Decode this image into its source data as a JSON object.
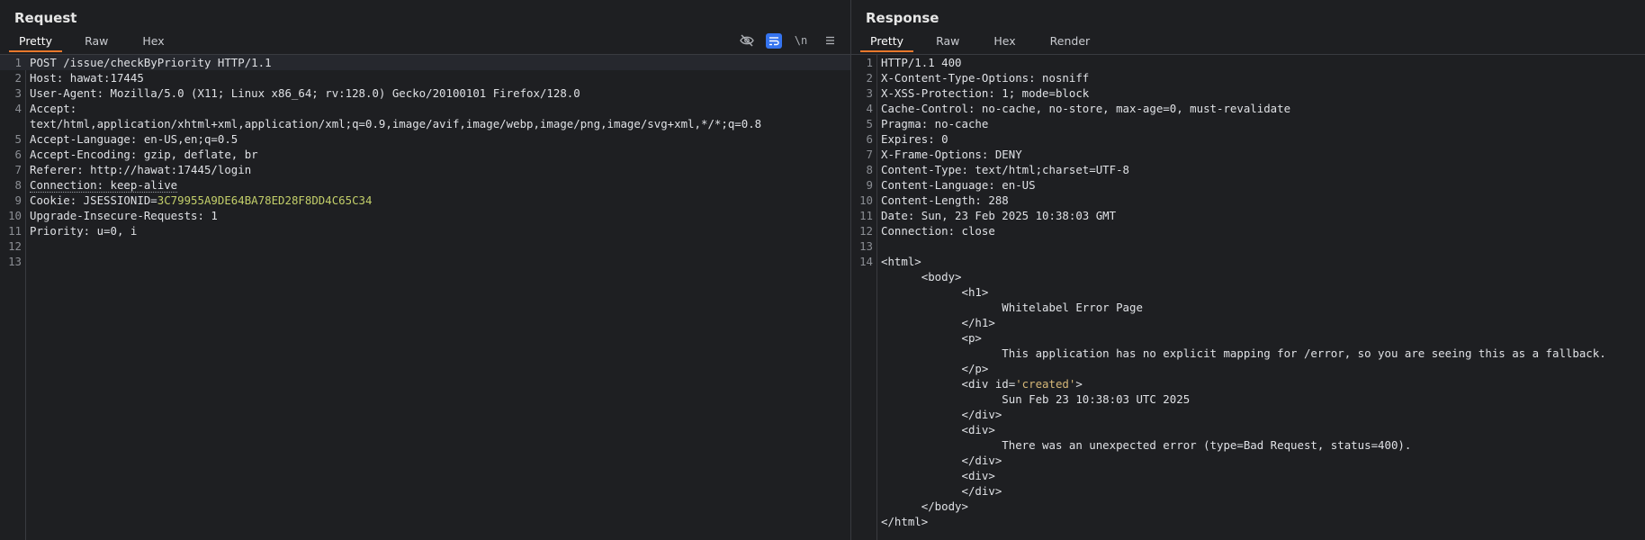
{
  "request": {
    "title": "Request",
    "tabs": [
      "Pretty",
      "Raw",
      "Hex"
    ],
    "active_tab": "Pretty",
    "toolbar": [
      "eye-off-icon",
      "wrap-icon",
      "\\n",
      "menu-icon"
    ],
    "lines": [
      {
        "n": "1",
        "text": "POST /issue/checkByPriority HTTP/1.1"
      },
      {
        "n": "2",
        "text": "Host: hawat:17445"
      },
      {
        "n": "3",
        "text": "User-Agent: Mozilla/5.0 (X11; Linux x86_64; rv:128.0) Gecko/20100101 Firefox/128.0"
      },
      {
        "n": "4",
        "text": "Accept:"
      },
      {
        "n": "",
        "text": "text/html,application/xhtml+xml,application/xml;q=0.9,image/avif,image/webp,image/png,image/svg+xml,*/*;q=0.8"
      },
      {
        "n": "5",
        "text": "Accept-Language: en-US,en;q=0.5"
      },
      {
        "n": "6",
        "text": "Accept-Encoding: gzip, deflate, br"
      },
      {
        "n": "7",
        "text": "Referer: http://hawat:17445/login"
      },
      {
        "n": "8",
        "text": "Connection: keep-alive"
      },
      {
        "n": "9",
        "key": "Cookie: JSESSIONID=",
        "value": "3C79955A9DE64BA78ED28F8DD4C65C34"
      },
      {
        "n": "10",
        "text": "Upgrade-Insecure-Requests: 1"
      },
      {
        "n": "11",
        "text": "Priority: u=0, i"
      },
      {
        "n": "12",
        "text": ""
      },
      {
        "n": "13",
        "text": ""
      }
    ]
  },
  "response": {
    "title": "Response",
    "tabs": [
      "Pretty",
      "Raw",
      "Hex",
      "Render"
    ],
    "active_tab": "Pretty",
    "lines": [
      {
        "n": "1",
        "text": "HTTP/1.1 400"
      },
      {
        "n": "2",
        "text": "X-Content-Type-Options: nosniff"
      },
      {
        "n": "3",
        "text": "X-XSS-Protection: 1; mode=block"
      },
      {
        "n": "4",
        "text": "Cache-Control: no-cache, no-store, max-age=0, must-revalidate"
      },
      {
        "n": "5",
        "text": "Pragma: no-cache"
      },
      {
        "n": "6",
        "text": "Expires: 0"
      },
      {
        "n": "7",
        "text": "X-Frame-Options: DENY"
      },
      {
        "n": "8",
        "text": "Content-Type: text/html;charset=UTF-8"
      },
      {
        "n": "9",
        "text": "Content-Language: en-US"
      },
      {
        "n": "10",
        "text": "Content-Length: 288"
      },
      {
        "n": "11",
        "text": "Date: Sun, 23 Feb 2025 10:38:03 GMT"
      },
      {
        "n": "12",
        "text": "Connection: close"
      },
      {
        "n": "13",
        "text": ""
      },
      {
        "n": "14",
        "text": "<html>"
      },
      {
        "n": "",
        "text": "      <body>"
      },
      {
        "n": "",
        "text": "            <h1>"
      },
      {
        "n": "",
        "text": "                  Whitelabel Error Page"
      },
      {
        "n": "",
        "text": "            </h1>"
      },
      {
        "n": "",
        "text": "            <p>"
      },
      {
        "n": "",
        "text": "                  This application has no explicit mapping for /error, so you are seeing this as a fallback."
      },
      {
        "n": "",
        "text": "            </p>"
      },
      {
        "n": "",
        "pre": "            <div id=",
        "value": "'created'",
        "post": ">"
      },
      {
        "n": "",
        "text": "                  Sun Feb 23 10:38:03 UTC 2025"
      },
      {
        "n": "",
        "text": "            </div>"
      },
      {
        "n": "",
        "text": "            <div>"
      },
      {
        "n": "",
        "text": "                  There was an unexpected error (type=Bad Request, status=400)."
      },
      {
        "n": "",
        "text": "            </div>"
      },
      {
        "n": "",
        "text": "            <div>"
      },
      {
        "n": "",
        "text": "            </div>"
      },
      {
        "n": "",
        "text": "      </body>"
      },
      {
        "n": "",
        "text": "</html>"
      }
    ]
  },
  "colors": {
    "accent_tab": "#e8782c",
    "toggle_on": "#3574f0",
    "cookie_value": "#c3cf6a",
    "attr_value": "#d5b778"
  }
}
